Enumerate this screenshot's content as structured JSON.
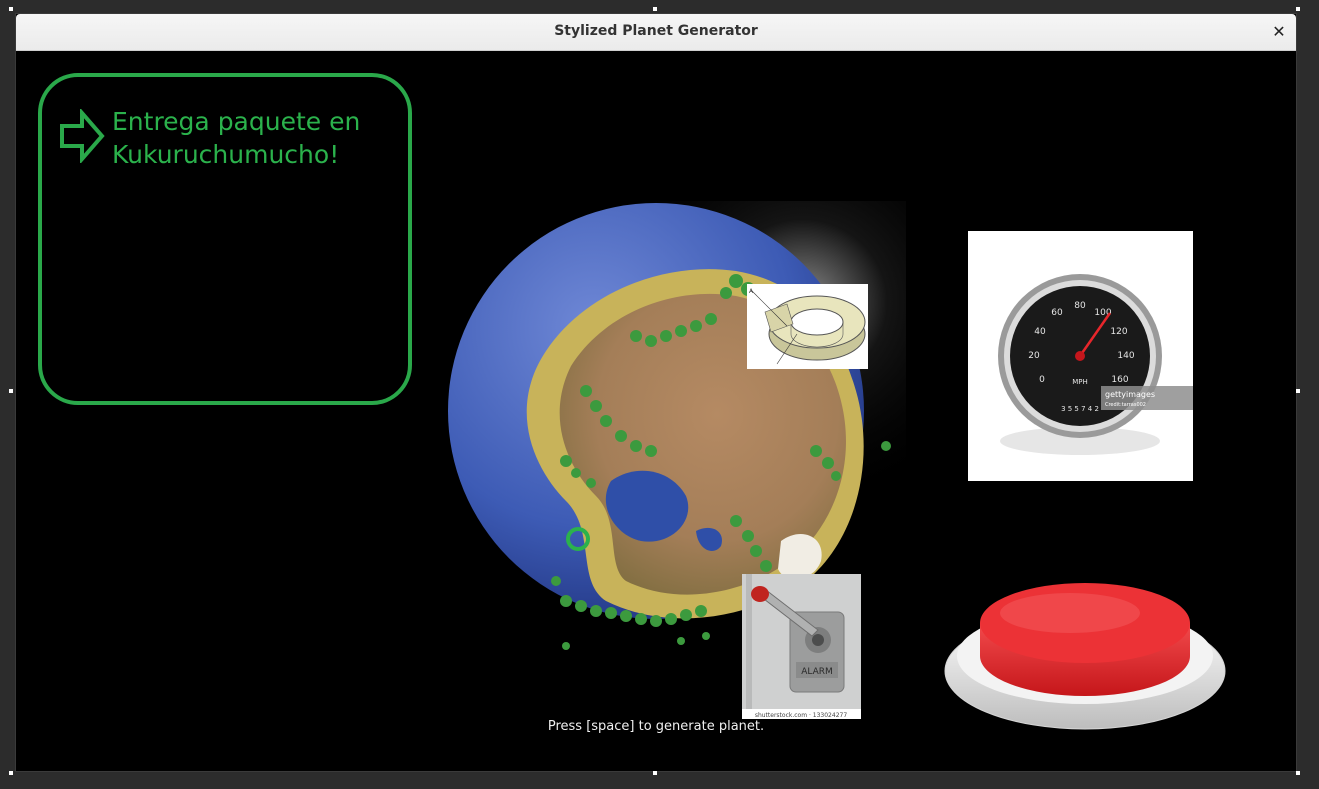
{
  "window": {
    "title": "Stylized Planet Generator",
    "close_glyph": "✕"
  },
  "quest": {
    "icon": "arrow-right-icon",
    "text_line1": "Entrega paquete en",
    "text_line2": "Kukuruchumucho!",
    "color": "#2aa84a"
  },
  "overlays": {
    "torus_label_a": "A",
    "speedometer": {
      "unit": "MPH",
      "ticks": [
        "0",
        "20",
        "40",
        "60",
        "80",
        "100",
        "120",
        "140",
        "160"
      ],
      "odometer": "3 5 5 7 4 2",
      "watermark": "gettyimages",
      "credit": "Credit:tarras002"
    },
    "lever": {
      "plate_text": "ALARM",
      "watermark": "shutterstock.com · 133024277"
    }
  },
  "hint": "Press [space] to generate planet.",
  "colors": {
    "accent_green": "#2bb24c",
    "ocean": "#3d5bb5",
    "button_red": "#e8262b"
  }
}
